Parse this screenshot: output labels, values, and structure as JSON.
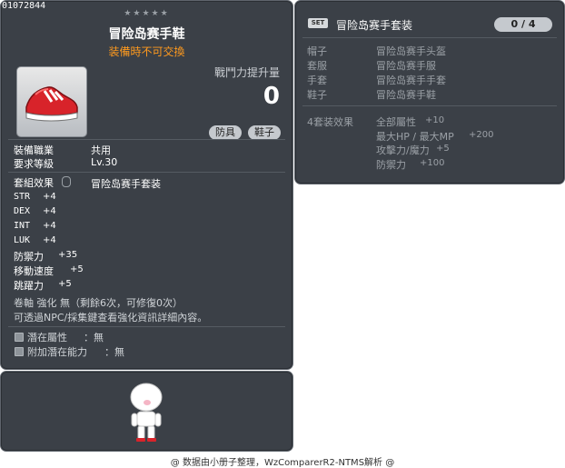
{
  "item": {
    "id": "01072844",
    "name": "冒险岛赛手鞋",
    "trade": "装備時不可交換",
    "icon": "red-sneaker-icon",
    "power_label": "戰鬥力提升量",
    "power_value": "0",
    "tags": [
      "防具",
      "鞋子"
    ],
    "job_label": "裝備職業",
    "job_value": "共用",
    "level_label": "要求等級",
    "level_value": "Lv.30",
    "set_label": "套組效果",
    "set_value": "冒险岛赛手套装",
    "stats": [
      {
        "name": "STR",
        "value": "+4"
      },
      {
        "name": "DEX",
        "value": "+4"
      },
      {
        "name": "INT",
        "value": "+4"
      },
      {
        "name": "LUK",
        "value": "+4"
      }
    ],
    "stats2": [
      {
        "name": "防禦力",
        "value": "+35"
      },
      {
        "name": "移動速度",
        "value": "+5"
      },
      {
        "name": "跳躍力",
        "value": "+5"
      }
    ],
    "upgrade_line": "卷軸 強化 無（剩餘6次，可修復0次）",
    "upgrade_hint": "可透過NPC/採集鍵查看強化資訊詳細內容。",
    "potential": {
      "label": "潛在屬性",
      "sep": "：",
      "value": "無"
    },
    "additional": {
      "label": "附加潛在能力",
      "sep": "：",
      "value": "無"
    }
  },
  "set": {
    "tag": "SET",
    "title": "冒险岛赛手套装",
    "count": "0 / 4",
    "parts": [
      {
        "slot": "帽子",
        "name": "冒险岛赛手头盔"
      },
      {
        "slot": "套服",
        "name": "冒险岛赛手服"
      },
      {
        "slot": "手套",
        "name": "冒险岛赛手手套"
      },
      {
        "slot": "鞋子",
        "name": "冒险岛赛手鞋"
      }
    ],
    "effect_label": "4套装效果",
    "effects": [
      {
        "name": "全部屬性",
        "value": "+10"
      },
      {
        "name": "最大HP / 最大MP",
        "value": "+200"
      },
      {
        "name": "攻擊力/魔力",
        "value": "+5"
      },
      {
        "name": "防禦力",
        "value": "+100"
      }
    ]
  },
  "footer": "@ 数据由小册子整理，WzComparerR2-NTMS解析 @"
}
